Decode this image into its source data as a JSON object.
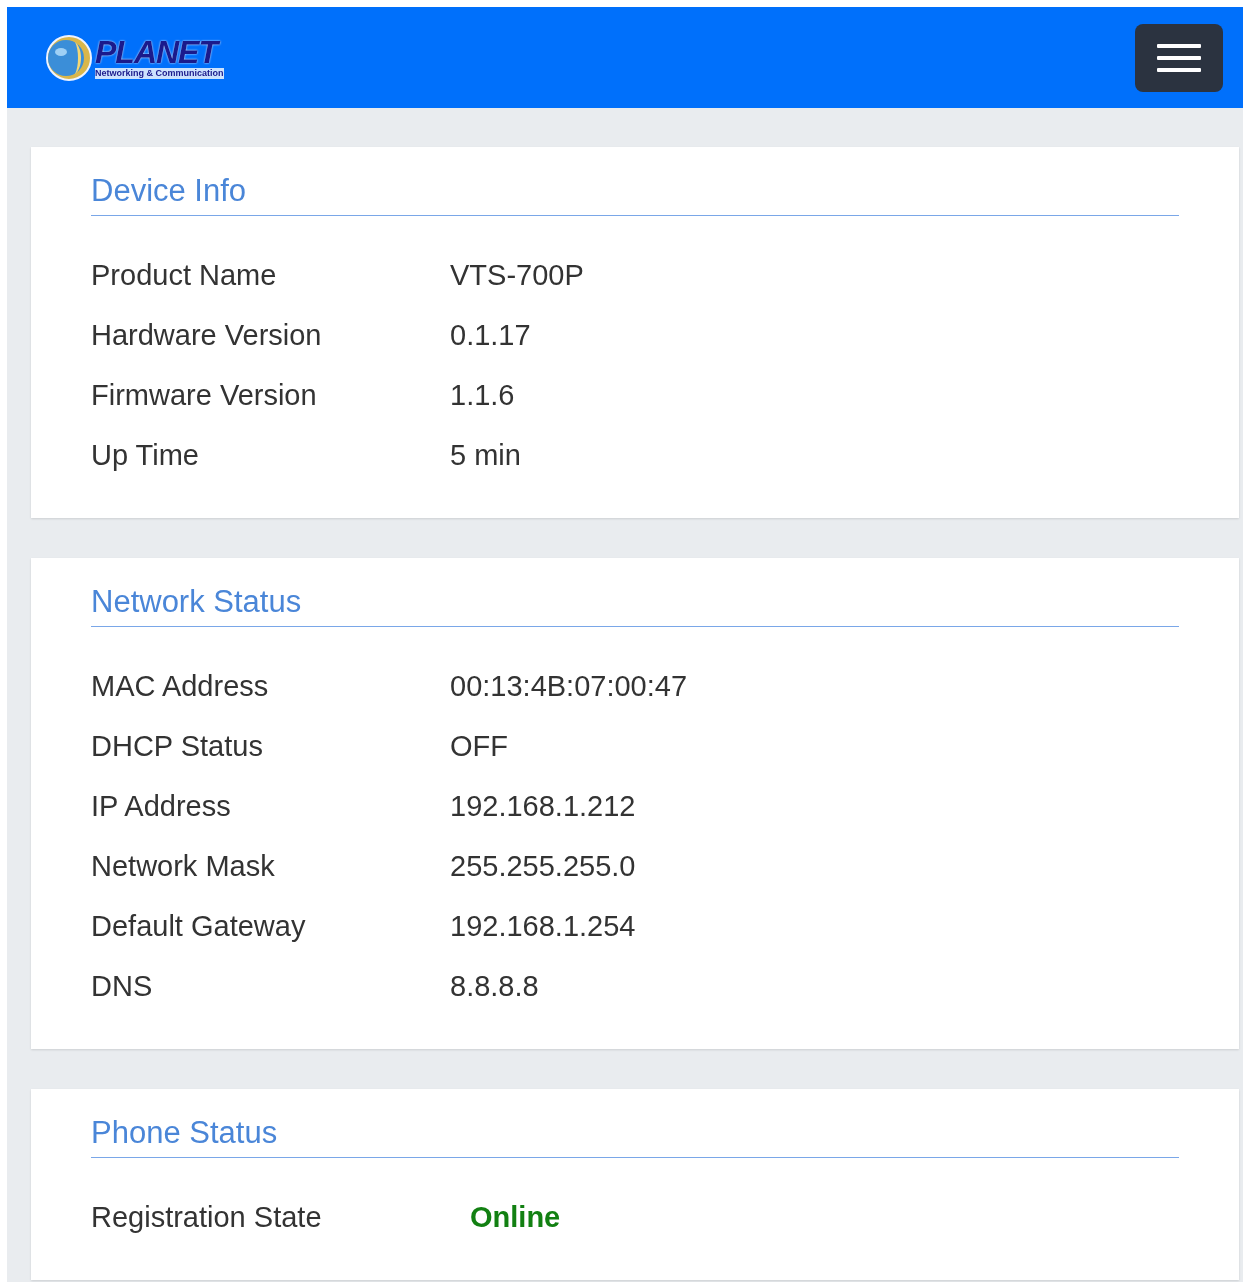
{
  "header": {
    "logo": {
      "brand": "PLANET",
      "tagline": "Networking & Communication"
    }
  },
  "sections": [
    {
      "title": "Device Info",
      "rows": [
        {
          "label": "Product Name",
          "value": "VTS-700P",
          "kind": "plain"
        },
        {
          "label": "Hardware Version",
          "value": "0.1.17",
          "kind": "plain"
        },
        {
          "label": "Firmware Version",
          "value": "1.1.6",
          "kind": "plain"
        },
        {
          "label": "Up Time",
          "value": "5 min",
          "kind": "plain"
        }
      ]
    },
    {
      "title": "Network Status",
      "rows": [
        {
          "label": "MAC Address",
          "value": "00:13:4B:07:00:47",
          "kind": "plain"
        },
        {
          "label": "DHCP Status",
          "value": "OFF",
          "kind": "plain"
        },
        {
          "label": "IP Address",
          "value": "192.168.1.212",
          "kind": "plain"
        },
        {
          "label": "Network Mask",
          "value": "255.255.255.0",
          "kind": "plain"
        },
        {
          "label": "Default Gateway",
          "value": "192.168.1.254",
          "kind": "plain"
        },
        {
          "label": "DNS",
          "value": "8.8.8.8",
          "kind": "plain"
        }
      ]
    },
    {
      "title": "Phone Status",
      "rows": [
        {
          "label": "Registration State",
          "value": "Online",
          "kind": "status"
        }
      ]
    }
  ]
}
